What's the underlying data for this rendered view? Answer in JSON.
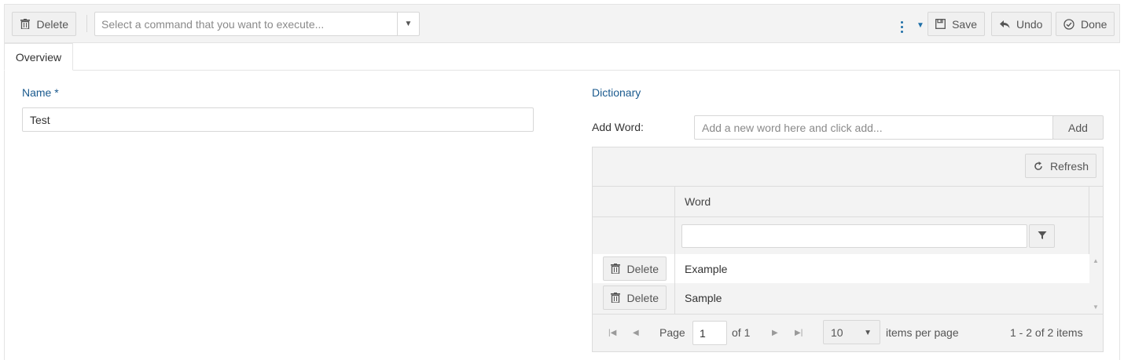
{
  "toolbar": {
    "delete_label": "Delete",
    "command_placeholder": "Select a command that you want to execute...",
    "save_label": "Save",
    "undo_label": "Undo",
    "done_label": "Done"
  },
  "tabs": [
    {
      "label": "Overview",
      "active": true
    }
  ],
  "form": {
    "name_label": "Name *",
    "name_value": "Test",
    "dictionary_label": "Dictionary",
    "add_word_label": "Add Word:",
    "add_word_placeholder": "Add a new word here and click add...",
    "add_button": "Add"
  },
  "grid": {
    "refresh_label": "Refresh",
    "column_header": "Word",
    "rows": [
      {
        "delete_label": "Delete",
        "word": "Example"
      },
      {
        "delete_label": "Delete",
        "word": "Sample"
      }
    ],
    "pager": {
      "page_label": "Page",
      "page_value": "1",
      "of_label": "of 1",
      "page_size": "10",
      "items_per_page_label": "items per page",
      "summary": "1 - 2 of 2 items"
    }
  },
  "colors": {
    "accent": "#1a5a8e",
    "toolbar_bg": "#f3f3f3",
    "border": "#d7d7d7"
  }
}
